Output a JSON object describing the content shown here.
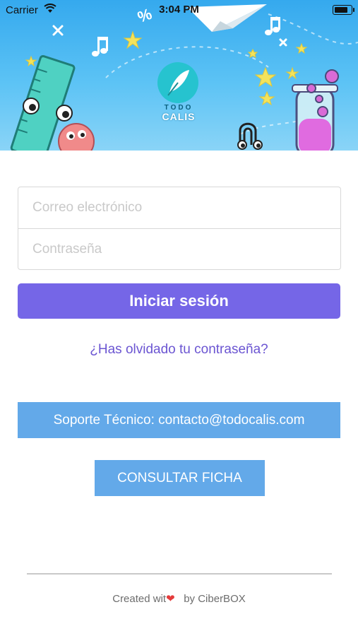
{
  "status_bar": {
    "carrier": "Carrier",
    "time": "3:04 PM"
  },
  "header": {
    "logo_top": "TODO",
    "logo_bottom": "CALIS",
    "colors": {
      "sky_top": "#35a9ee",
      "sky_bottom": "#8ad4f7",
      "logo": "#26c3cf"
    }
  },
  "login_form": {
    "email_placeholder": "Correo electrónico",
    "password_placeholder": "Contraseña",
    "submit_label": "Iniciar sesión",
    "forgot_link": "¿Has olvidado tu contraseña?"
  },
  "support": {
    "label": "Soporte Técnico: contacto@todocalis.com"
  },
  "consult": {
    "label": "CONSULTAR FICHA"
  },
  "footer": {
    "prefix": "Created wit",
    "heart_icon": "heart-icon",
    "suffix": "by CiberBOX"
  },
  "colors": {
    "primary_button": "#7566e7",
    "secondary_button": "#63a9e9",
    "link": "#6b55d2"
  }
}
